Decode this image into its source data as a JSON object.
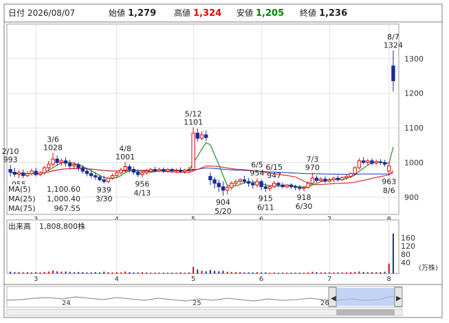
{
  "header": {
    "date_label": "日付",
    "date_value": "2026/08/07",
    "open_label": "始値",
    "open_value": "1,279",
    "high_label": "高値",
    "high_value": "1,324",
    "low_label": "安値",
    "low_value": "1,205",
    "close_label": "終値",
    "close_value": "1,236",
    "high_color": "#e60000",
    "low_color": "#008000"
  },
  "legend": {
    "ma5_label": "MA(5)",
    "ma5_value": "1,100.60",
    "ma25_label": "MA(25)",
    "ma25_value": "1,000.40",
    "ma75_label": "MA(75)",
    "ma75_value": "967.55",
    "ma5_color": "#228b22",
    "ma25_color": "#e03030",
    "ma75_color": "#3050d0"
  },
  "volume_panel": {
    "title": "出来高",
    "value": "1,808,800株",
    "unit": "(万株)",
    "ticks": [
      "160",
      "120",
      "80",
      "40"
    ]
  },
  "navigator": {
    "labels": [
      "24",
      "25",
      "26"
    ]
  },
  "chart_data": {
    "type": "candlestick",
    "y_range": [
      850,
      1400
    ],
    "y_ticks": [
      900,
      1000,
      1100,
      1200,
      1300
    ],
    "x_month_labels": [
      "3",
      "4",
      "5",
      "6",
      "7",
      "8"
    ],
    "candles": [
      {
        "o": 980,
        "h": 993,
        "c": 972,
        "l": 960,
        "v": 8
      },
      {
        "o": 972,
        "h": 985,
        "c": 966,
        "l": 958,
        "v": 6
      },
      {
        "o": 966,
        "h": 978,
        "c": 970,
        "l": 955,
        "v": 7
      },
      {
        "o": 970,
        "h": 980,
        "c": 962,
        "l": 955,
        "v": 5
      },
      {
        "o": 962,
        "h": 975,
        "c": 968,
        "l": 958,
        "v": 6
      },
      {
        "o": 968,
        "h": 982,
        "c": 975,
        "l": 962,
        "v": 5
      },
      {
        "o": 975,
        "h": 985,
        "c": 965,
        "l": 960,
        "v": 6
      },
      {
        "o": 965,
        "h": 975,
        "c": 970,
        "l": 960,
        "v": 5
      },
      {
        "o": 970,
        "h": 990,
        "c": 985,
        "l": 965,
        "v": 7
      },
      {
        "o": 985,
        "h": 1005,
        "c": 995,
        "l": 975,
        "v": 9
      },
      {
        "o": 995,
        "h": 1028,
        "c": 1010,
        "l": 988,
        "v": 14
      },
      {
        "o": 1010,
        "h": 1020,
        "c": 1000,
        "l": 992,
        "v": 10
      },
      {
        "o": 1000,
        "h": 1012,
        "c": 1005,
        "l": 990,
        "v": 8
      },
      {
        "o": 1005,
        "h": 1015,
        "c": 998,
        "l": 988,
        "v": 9
      },
      {
        "o": 998,
        "h": 1008,
        "c": 990,
        "l": 982,
        "v": 7
      },
      {
        "o": 990,
        "h": 1002,
        "c": 994,
        "l": 980,
        "v": 6
      },
      {
        "o": 994,
        "h": 1000,
        "c": 985,
        "l": 975,
        "v": 7
      },
      {
        "o": 985,
        "h": 992,
        "c": 975,
        "l": 968,
        "v": 6
      },
      {
        "o": 975,
        "h": 985,
        "c": 968,
        "l": 960,
        "v": 5
      },
      {
        "o": 968,
        "h": 978,
        "c": 962,
        "l": 955,
        "v": 5
      },
      {
        "o": 962,
        "h": 972,
        "c": 958,
        "l": 950,
        "v": 6
      },
      {
        "o": 958,
        "h": 965,
        "c": 950,
        "l": 945,
        "v": 5
      },
      {
        "o": 950,
        "h": 962,
        "c": 945,
        "l": 939,
        "v": 8
      },
      {
        "o": 945,
        "h": 958,
        "c": 955,
        "l": 940,
        "v": 6
      },
      {
        "o": 955,
        "h": 968,
        "c": 962,
        "l": 950,
        "v": 5
      },
      {
        "o": 962,
        "h": 975,
        "c": 970,
        "l": 958,
        "v": 6
      },
      {
        "o": 970,
        "h": 985,
        "c": 978,
        "l": 965,
        "v": 5
      },
      {
        "o": 978,
        "h": 1001,
        "c": 988,
        "l": 972,
        "v": 9
      },
      {
        "o": 988,
        "h": 995,
        "c": 980,
        "l": 970,
        "v": 6
      },
      {
        "o": 980,
        "h": 988,
        "c": 972,
        "l": 965,
        "v": 5
      },
      {
        "o": 972,
        "h": 980,
        "c": 965,
        "l": 958,
        "v": 5
      },
      {
        "o": 965,
        "h": 975,
        "c": 970,
        "l": 956,
        "v": 6
      },
      {
        "o": 970,
        "h": 982,
        "c": 975,
        "l": 965,
        "v": 5
      },
      {
        "o": 975,
        "h": 985,
        "c": 980,
        "l": 970,
        "v": 4
      },
      {
        "o": 980,
        "h": 988,
        "c": 976,
        "l": 972,
        "v": 4
      },
      {
        "o": 976,
        "h": 985,
        "c": 980,
        "l": 972,
        "v": 4
      },
      {
        "o": 980,
        "h": 986,
        "c": 975,
        "l": 970,
        "v": 4
      },
      {
        "o": 975,
        "h": 984,
        "c": 980,
        "l": 972,
        "v": 4
      },
      {
        "o": 980,
        "h": 985,
        "c": 976,
        "l": 971,
        "v": 4
      },
      {
        "o": 976,
        "h": 983,
        "c": 978,
        "l": 970,
        "v": 4
      },
      {
        "o": 978,
        "h": 986,
        "c": 974,
        "l": 970,
        "v": 5
      },
      {
        "o": 974,
        "h": 982,
        "c": 978,
        "l": 968,
        "v": 4
      },
      {
        "o": 978,
        "h": 988,
        "c": 980,
        "l": 972,
        "v": 5
      },
      {
        "o": 980,
        "h": 1101,
        "c": 1085,
        "l": 975,
        "v": 30
      },
      {
        "o": 1085,
        "h": 1098,
        "c": 1070,
        "l": 1060,
        "v": 18
      },
      {
        "o": 1070,
        "h": 1090,
        "c": 1080,
        "l": 1065,
        "v": 12
      },
      {
        "o": 1080,
        "h": 1092,
        "c": 1072,
        "l": 1062,
        "v": 10
      },
      {
        "o": 960,
        "h": 972,
        "c": 950,
        "l": 935,
        "v": 16
      },
      {
        "o": 950,
        "h": 958,
        "c": 940,
        "l": 925,
        "v": 12
      },
      {
        "o": 940,
        "h": 950,
        "c": 930,
        "l": 915,
        "v": 10
      },
      {
        "o": 930,
        "h": 945,
        "c": 920,
        "l": 904,
        "v": 12
      },
      {
        "o": 920,
        "h": 935,
        "c": 928,
        "l": 908,
        "v": 8
      },
      {
        "o": 928,
        "h": 945,
        "c": 940,
        "l": 920,
        "v": 7
      },
      {
        "o": 940,
        "h": 950,
        "c": 945,
        "l": 932,
        "v": 6
      },
      {
        "o": 945,
        "h": 955,
        "c": 950,
        "l": 938,
        "v": 6
      },
      {
        "o": 950,
        "h": 962,
        "c": 945,
        "l": 938,
        "v": 5
      },
      {
        "o": 945,
        "h": 955,
        "c": 940,
        "l": 930,
        "v": 5
      },
      {
        "o": 940,
        "h": 950,
        "c": 935,
        "l": 925,
        "v": 5
      },
      {
        "o": 935,
        "h": 954,
        "c": 945,
        "l": 928,
        "v": 6
      },
      {
        "o": 945,
        "h": 950,
        "c": 930,
        "l": 920,
        "v": 5
      },
      {
        "o": 930,
        "h": 940,
        "c": 925,
        "l": 915,
        "v": 5
      },
      {
        "o": 925,
        "h": 935,
        "c": 930,
        "l": 918,
        "v": 4
      },
      {
        "o": 930,
        "h": 947,
        "c": 940,
        "l": 925,
        "v": 5
      },
      {
        "o": 940,
        "h": 945,
        "c": 935,
        "l": 928,
        "v": 4
      },
      {
        "o": 935,
        "h": 942,
        "c": 930,
        "l": 925,
        "v": 4
      },
      {
        "o": 930,
        "h": 938,
        "c": 935,
        "l": 925,
        "v": 4
      },
      {
        "o": 935,
        "h": 940,
        "c": 930,
        "l": 924,
        "v": 4
      },
      {
        "o": 930,
        "h": 936,
        "c": 928,
        "l": 920,
        "v": 4
      },
      {
        "o": 928,
        "h": 935,
        "c": 925,
        "l": 918,
        "v": 4
      },
      {
        "o": 925,
        "h": 932,
        "c": 928,
        "l": 918,
        "v": 4
      },
      {
        "o": 928,
        "h": 945,
        "c": 940,
        "l": 924,
        "v": 5
      },
      {
        "o": 940,
        "h": 970,
        "c": 955,
        "l": 935,
        "v": 8
      },
      {
        "o": 955,
        "h": 962,
        "c": 948,
        "l": 942,
        "v": 6
      },
      {
        "o": 948,
        "h": 958,
        "c": 952,
        "l": 944,
        "v": 5
      },
      {
        "o": 952,
        "h": 960,
        "c": 946,
        "l": 940,
        "v": 5
      },
      {
        "o": 946,
        "h": 955,
        "c": 950,
        "l": 942,
        "v": 5
      },
      {
        "o": 950,
        "h": 958,
        "c": 955,
        "l": 944,
        "v": 5
      },
      {
        "o": 955,
        "h": 962,
        "c": 950,
        "l": 945,
        "v": 5
      },
      {
        "o": 950,
        "h": 960,
        "c": 956,
        "l": 946,
        "v": 5
      },
      {
        "o": 956,
        "h": 965,
        "c": 960,
        "l": 950,
        "v": 5
      },
      {
        "o": 960,
        "h": 972,
        "c": 968,
        "l": 955,
        "v": 6
      },
      {
        "o": 968,
        "h": 990,
        "c": 985,
        "l": 962,
        "v": 7
      },
      {
        "o": 985,
        "h": 1012,
        "c": 1005,
        "l": 980,
        "v": 9
      },
      {
        "o": 1005,
        "h": 1015,
        "c": 1000,
        "l": 995,
        "v": 7
      },
      {
        "o": 1000,
        "h": 1010,
        "c": 1005,
        "l": 994,
        "v": 6
      },
      {
        "o": 1005,
        "h": 1012,
        "c": 998,
        "l": 992,
        "v": 6
      },
      {
        "o": 998,
        "h": 1008,
        "c": 1002,
        "l": 994,
        "v": 6
      },
      {
        "o": 1002,
        "h": 1010,
        "c": 1000,
        "l": 993,
        "v": 6
      },
      {
        "o": 1000,
        "h": 1008,
        "c": 995,
        "l": 988,
        "v": 8
      },
      {
        "o": 975,
        "h": 1000,
        "c": 990,
        "l": 963,
        "v": 45
      },
      {
        "o": 1279,
        "h": 1324,
        "c": 1236,
        "l": 1205,
        "v": 180.88
      }
    ],
    "ma5_last": 1100.6,
    "ma25_last": 1000.4,
    "ma75_last": 967.55,
    "annotations": [
      {
        "i": 0,
        "date": "2/10",
        "price": "993",
        "pos": "above"
      },
      {
        "i": 2,
        "date": "",
        "price": "955",
        "pos": "below"
      },
      {
        "i": 10,
        "date": "3/6",
        "price": "1028",
        "pos": "above"
      },
      {
        "i": 22,
        "date": "3/30",
        "price": "939",
        "pos": "below"
      },
      {
        "i": 27,
        "date": "4/8",
        "price": "1001",
        "pos": "above"
      },
      {
        "i": 31,
        "date": "4/13",
        "price": "956",
        "pos": "below"
      },
      {
        "i": 43,
        "date": "5/12",
        "price": "1101",
        "pos": "above"
      },
      {
        "i": 50,
        "date": "5/20",
        "price": "904",
        "pos": "below"
      },
      {
        "i": 58,
        "date": "6/5",
        "price": "954",
        "pos": "above"
      },
      {
        "i": 60,
        "date": "6/11",
        "price": "915",
        "pos": "below"
      },
      {
        "i": 62,
        "date": "6/15",
        "price": "947",
        "pos": "above"
      },
      {
        "i": 69,
        "date": "6/30",
        "price": "918",
        "pos": "below"
      },
      {
        "i": 71,
        "date": "7/3",
        "price": "970",
        "pos": "above"
      },
      {
        "i": 89,
        "date": "8/6",
        "price": "963",
        "pos": "below"
      },
      {
        "i": 90,
        "date": "8/7",
        "price": "1324",
        "pos": "above"
      }
    ]
  }
}
